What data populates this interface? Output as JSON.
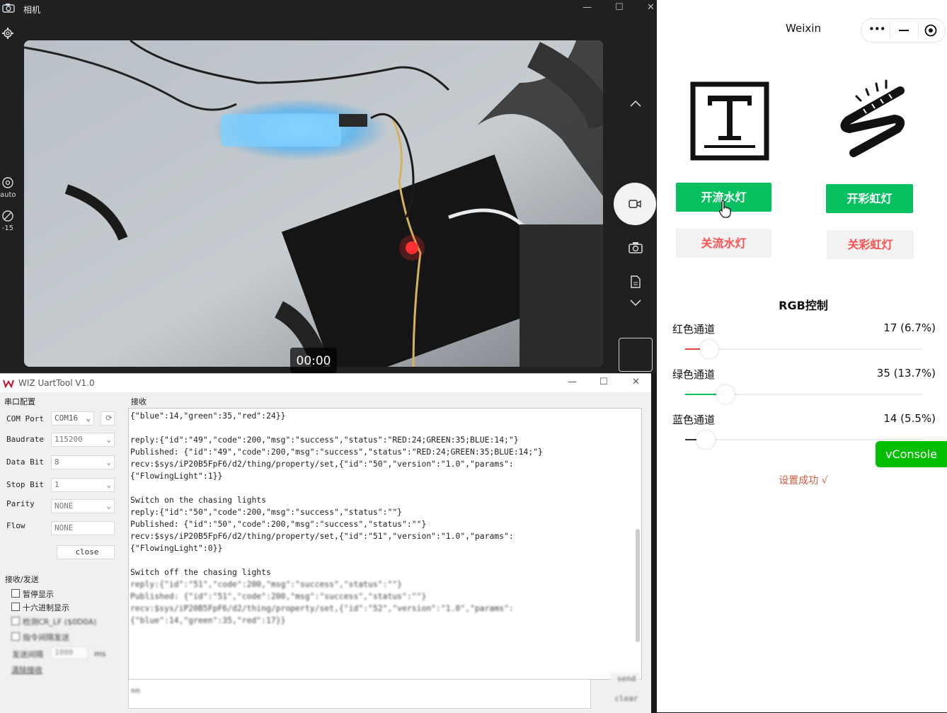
{
  "camera": {
    "title": "相机",
    "auto_label": "auto",
    "exposure_label": "-15",
    "timer": "00:00"
  },
  "uart": {
    "title": "WIZ UartTool V1.0",
    "config_title": "串口配置",
    "receive_title": "接收",
    "com_port": {
      "label": "COM Port",
      "value": "COM16"
    },
    "baudrate": {
      "label": "Baudrate",
      "value": "115200"
    },
    "data_bit": {
      "label": "Data Bit",
      "value": "8"
    },
    "stop_bit": {
      "label": "Stop Bit",
      "value": "1"
    },
    "parity": {
      "label": "Parity",
      "value": "NONE"
    },
    "flow": {
      "label": "Flow",
      "value": "NONE"
    },
    "close_label": "close",
    "rs_title": "接收/发送",
    "options": [
      "暂停显示",
      "十六进制显示",
      "检测CR_LF ($0D0A)",
      "指令间隔发送"
    ],
    "interval_label": "发送间隔",
    "interval_value": "1000",
    "interval_unit": "ms",
    "clear_recv": "清除接收",
    "send_text": "nn",
    "send_label": "send",
    "clear_label": "clear",
    "log": [
      "{\"blue\":14,\"green\":35,\"red\":24}}",
      "",
      "reply:{\"id\":\"49\",\"code\":200,\"msg\":\"success\",\"status\":\"RED:24;GREEN:35;BLUE:14;\"}",
      "Published: {\"id\":\"49\",\"code\":200,\"msg\":\"success\",\"status\":\"RED:24;GREEN:35;BLUE:14;\"}",
      "recv:$sys/iP20B5FpF6/d2/thing/property/set,{\"id\":\"50\",\"version\":\"1.0\",\"params\":",
      "{\"FlowingLight\":1}}",
      "",
      "Switch on the chasing lights",
      "reply:{\"id\":\"50\",\"code\":200,\"msg\":\"success\",\"status\":\"\"}",
      "Published: {\"id\":\"50\",\"code\":200,\"msg\":\"success\",\"status\":\"\"}",
      "recv:$sys/iP20B5FpF6/d2/thing/property/set,{\"id\":\"51\",\"version\":\"1.0\",\"params\":",
      "{\"FlowingLight\":0}}",
      "",
      "Switch off the chasing lights",
      "reply:{\"id\":\"51\",\"code\":200,\"msg\":\"success\",\"status\":\"\"}",
      "Published: {\"id\":\"51\",\"code\":200,\"msg\":\"success\",\"status\":\"\"}",
      "recv:$sys/iP20B5FpF6/d2/thing/property/set,{\"id\":\"52\",\"version\":\"1.0\",\"params\":",
      "{\"blue\":14,\"green\":35,\"red\":17}}"
    ]
  },
  "weixin": {
    "title": "Weixin",
    "btn_flow_on": "开流水灯",
    "btn_rainbow_on": "开彩虹灯",
    "btn_flow_off": "关流水灯",
    "btn_rainbow_off": "关彩虹灯",
    "rgb_title": "RGB控制",
    "channels": [
      {
        "label": "红色通道",
        "value": "17 (6.7%)",
        "fraction": 0.067,
        "color": "#e64340"
      },
      {
        "label": "绿色通道",
        "value": "35 (13.7%)",
        "fraction": 0.137,
        "color": "#07c160"
      },
      {
        "label": "蓝色通道",
        "value": "14 (5.5%)",
        "fraction": 0.055,
        "color": "#333333"
      }
    ],
    "vconsole": "vConsole",
    "status": "设置成功 √"
  }
}
